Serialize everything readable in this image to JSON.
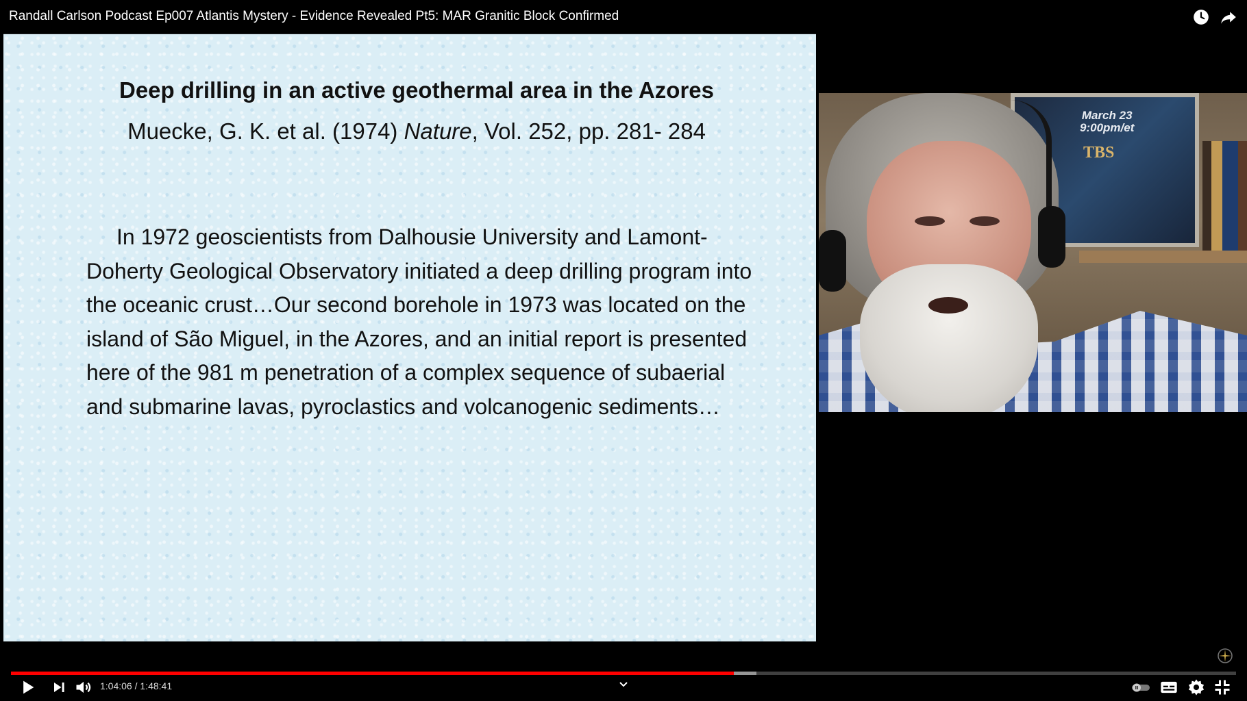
{
  "header": {
    "title": "Randall Carlson Podcast Ep007 Atlantis Mystery - Evidence Revealed Pt5: MAR Granitic Block Confirmed",
    "icons": [
      "clock-icon",
      "share-icon"
    ]
  },
  "slide": {
    "heading": "Deep drilling in an active geothermal area in the Azores",
    "citation_prefix": "Muecke, G. K. et al. (1974) ",
    "citation_journal": "Nature",
    "citation_suffix": ", Vol. 252, pp. 281- 284",
    "body": "In 1972 geoscientists from Dalhousie University and Lamont-Doherty Geological Observatory initiated a deep drilling program into the oceanic crust…Our second borehole in 1973 was located on the island of São Miguel, in the Azores, and an initial report is presented here of the 981 m penetration of a complex sequence of subaerial and submarine lavas, pyroclastics and volcanogenic sediments…"
  },
  "webcam": {
    "poster_date": "March 23\n9:00pm/et",
    "poster_logo": "TBS"
  },
  "player": {
    "current_time": "1:04:06",
    "separator": " / ",
    "duration": "1:48:41",
    "progress_played_fraction": 0.5899,
    "progress_buffered_fraction": 0.6085,
    "accent_color": "#ff0000",
    "icons": [
      "play-icon",
      "next-icon",
      "volume-icon",
      "chevron-down-icon",
      "autoplay-toggle-icon",
      "subtitles-icon",
      "settings-icon",
      "exit-fullscreen-icon"
    ]
  }
}
